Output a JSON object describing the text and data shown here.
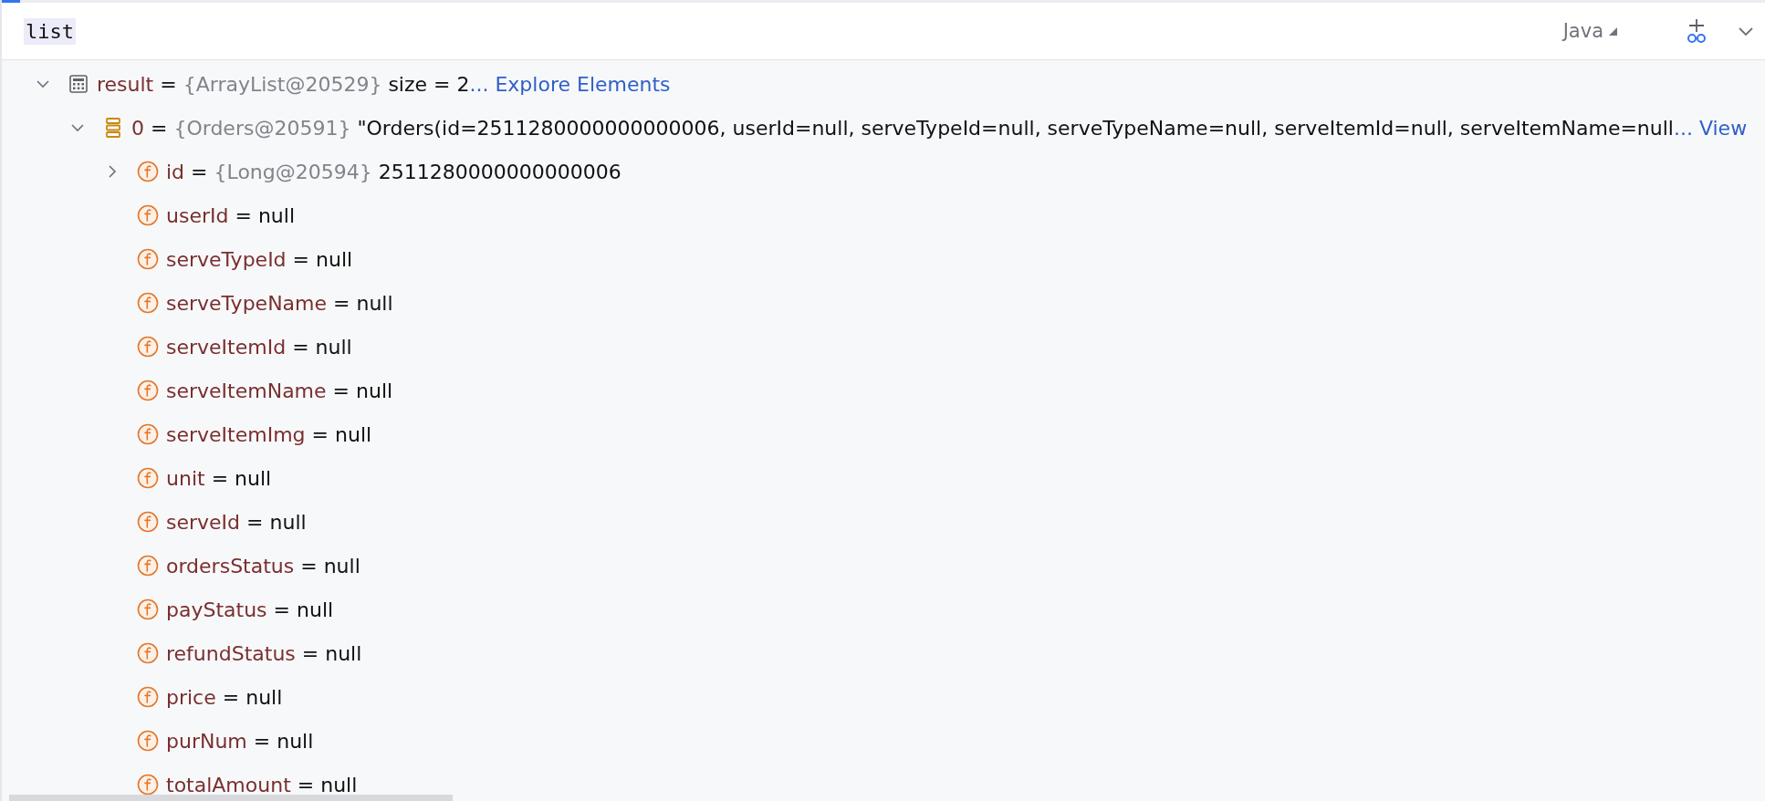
{
  "editor": {
    "expression": "list",
    "language": "Java"
  },
  "tree": [
    {
      "kind": "array",
      "name": "result",
      "equals": "=",
      "type": "{ArrayList@20529}",
      "value": " size = 2",
      "link": "... Explore Elements",
      "expanded": true,
      "children": [
        {
          "kind": "object",
          "name": "0",
          "equals": "=",
          "type": "{Orders@20591}",
          "value": "\"Orders(id=2511280000000000006, userId=null, serveTypeId=null, serveTypeName=null, serveItemId=null, serveItemName=null",
          "link": "... View",
          "expanded": true,
          "children": [
            {
              "kind": "field",
              "name": "id",
              "equals": "=",
              "type": "{Long@20594}",
              "value": "2511280000000000006",
              "expanded": false
            },
            {
              "kind": "field",
              "name": "userId",
              "equals": "=",
              "value": "null"
            },
            {
              "kind": "field",
              "name": "serveTypeId",
              "equals": "=",
              "value": "null"
            },
            {
              "kind": "field",
              "name": "serveTypeName",
              "equals": "=",
              "value": "null"
            },
            {
              "kind": "field",
              "name": "serveItemId",
              "equals": "=",
              "value": "null"
            },
            {
              "kind": "field",
              "name": "serveItemName",
              "equals": "=",
              "value": "null"
            },
            {
              "kind": "field",
              "name": "serveItemImg",
              "equals": "=",
              "value": "null"
            },
            {
              "kind": "field",
              "name": "unit",
              "equals": "=",
              "value": "null"
            },
            {
              "kind": "field",
              "name": "serveId",
              "equals": "=",
              "value": "null"
            },
            {
              "kind": "field",
              "name": "ordersStatus",
              "equals": "=",
              "value": "null"
            },
            {
              "kind": "field",
              "name": "payStatus",
              "equals": "=",
              "value": "null"
            },
            {
              "kind": "field",
              "name": "refundStatus",
              "equals": "=",
              "value": "null"
            },
            {
              "kind": "field",
              "name": "price",
              "equals": "=",
              "value": "null"
            },
            {
              "kind": "field",
              "name": "purNum",
              "equals": "=",
              "value": "null"
            },
            {
              "kind": "field",
              "name": "totalAmount",
              "equals": "=",
              "value": "null"
            }
          ]
        }
      ]
    }
  ]
}
